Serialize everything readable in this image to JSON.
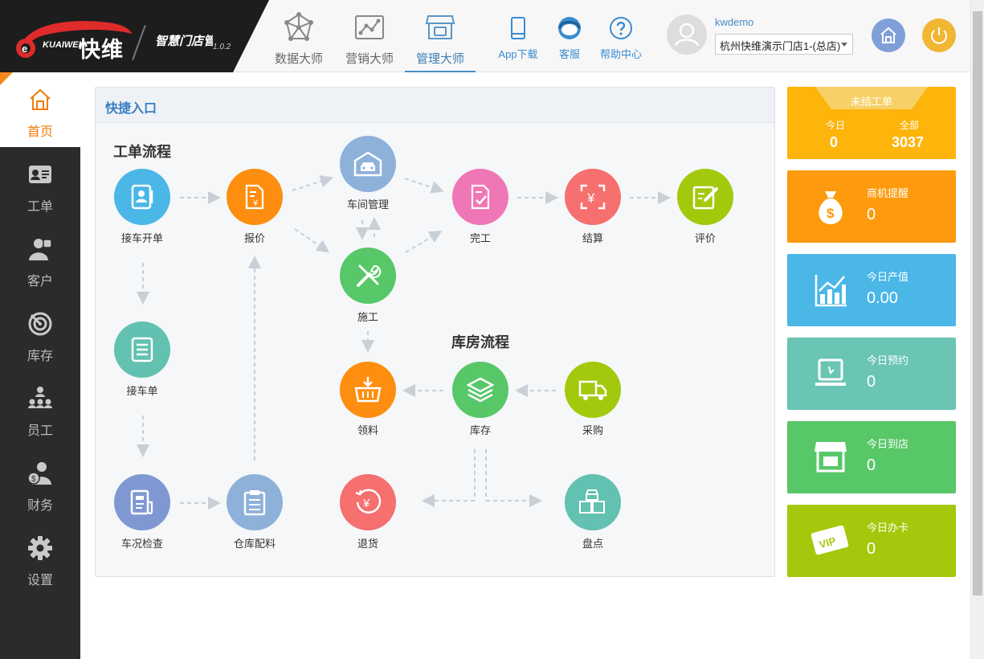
{
  "header": {
    "brand_en": "KUAIWEI",
    "brand_cn": "快维",
    "sub_title": "智慧门店管理系统",
    "version": "1.0.2",
    "nav": [
      {
        "label": "数据大师",
        "icon": "network-icon"
      },
      {
        "label": "营销大师",
        "icon": "marketing-chart-icon"
      },
      {
        "label": "管理大师",
        "icon": "store-icon",
        "active": true
      }
    ],
    "tools": [
      {
        "label": "App下载",
        "icon": "phone-icon"
      },
      {
        "label": "客服",
        "icon": "headset-icon"
      },
      {
        "label": "帮助中心",
        "icon": "question-icon"
      }
    ],
    "username": "kwdemo",
    "store_selected": "杭州快维演示门店1-(总店)"
  },
  "sidebar": {
    "items": [
      {
        "label": "首页",
        "icon": "home-icon",
        "active": true
      },
      {
        "label": "工单",
        "icon": "work-order-icon"
      },
      {
        "label": "客户",
        "icon": "customer-icon"
      },
      {
        "label": "库存",
        "icon": "inventory-icon"
      },
      {
        "label": "员工",
        "icon": "staff-icon"
      },
      {
        "label": "财务",
        "icon": "finance-icon"
      },
      {
        "label": "设置",
        "icon": "gear-icon"
      }
    ]
  },
  "quick": {
    "title": "快捷入口",
    "workflow_title": "工单流程",
    "warehouse_title": "库房流程",
    "nodes": {
      "pickup": "接车开单",
      "quote": "报价",
      "workshop": "车间管理",
      "construction": "施工",
      "complete": "完工",
      "settle": "结算",
      "review": "评价",
      "receipt": "接车单",
      "inspection": "车况检查",
      "material_prep": "仓库配料",
      "material_pick": "领料",
      "stock": "库存",
      "purchase": "采购",
      "returns": "退货",
      "count": "盘点"
    }
  },
  "stats": {
    "open_orders": {
      "title": "未结工单",
      "today_label": "今日",
      "today": "0",
      "all_label": "全部",
      "all": "3037"
    },
    "cards": [
      {
        "title": "商机提醒",
        "value": "0",
        "color": "#fd9a0d",
        "icon": "money-bag-icon"
      },
      {
        "title": "今日产值",
        "value": "0.00",
        "color": "#4ab7e7",
        "icon": "growth-chart-icon"
      },
      {
        "title": "今日预约",
        "value": "0",
        "color": "#6ac5b4",
        "icon": "laptop-icon"
      },
      {
        "title": "今日到店",
        "value": "0",
        "color": "#58c768",
        "icon": "shop-icon"
      },
      {
        "title": "今日办卡",
        "value": "0",
        "color": "#a4c90c",
        "icon": "vip-card-icon"
      }
    ]
  },
  "colors": {
    "accent": "#f07d0c",
    "blue": "#4ab7e7",
    "orange": "#fd8e10",
    "pink": "#f077b6",
    "red": "#f5706e",
    "green": "#57c768",
    "lime": "#a3c90d",
    "teal": "#62c1b0",
    "steel": "#8faed8"
  }
}
